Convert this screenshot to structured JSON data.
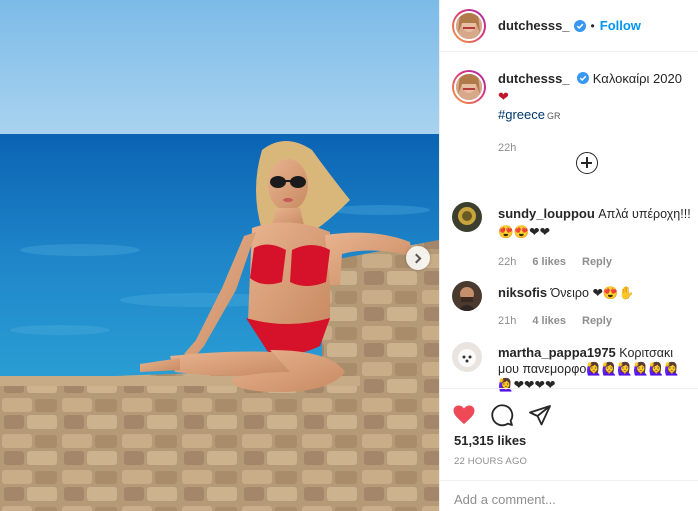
{
  "post": {
    "username": "dutchesss_",
    "verified": true,
    "follow_label": "Follow",
    "dot": "•",
    "caption_text": "Καλοκαίρι 2020",
    "caption_heart": "❤",
    "hashtag": "#greece",
    "hashtag_geo": "GR",
    "caption_time": "22h",
    "likes": "51,315 likes",
    "posted_ago": "22 HOURS AGO",
    "add_comment_placeholder": "Add a comment..."
  },
  "comments": [
    {
      "username": "sundy_louppou",
      "text": "Απλά υπέροχη!!!",
      "emoji_line": "😍😍❤❤",
      "time": "22h",
      "likes": "6 likes",
      "reply": "Reply"
    },
    {
      "username": "niksofis",
      "text": "Όνειρο",
      "emoji_line": "❤😍✋",
      "time": "21h",
      "likes": "4 likes",
      "reply": "Reply"
    },
    {
      "username": "martha_pappa1975",
      "text": "Κοριτσακι",
      "text2": "μου πανεμορφο",
      "emoji_line": "🙋‍♀️🙋‍♀️🙋‍♀️🙋‍♀️🙋‍♀️🙋‍♀️",
      "emoji_line2": "🙋‍♀️❤❤❤❤"
    }
  ],
  "colors": {
    "like_red": "#ed4956",
    "link_blue": "#0095f6",
    "hashtag_blue": "#00376b",
    "muted": "#8e8e8e"
  },
  "icons": {
    "verified": "verified-badge-icon",
    "like": "heart-icon",
    "comment": "comment-bubble-icon",
    "share": "paper-plane-icon",
    "load_more": "plus-circle-icon",
    "carousel": "chevron-right-icon"
  }
}
